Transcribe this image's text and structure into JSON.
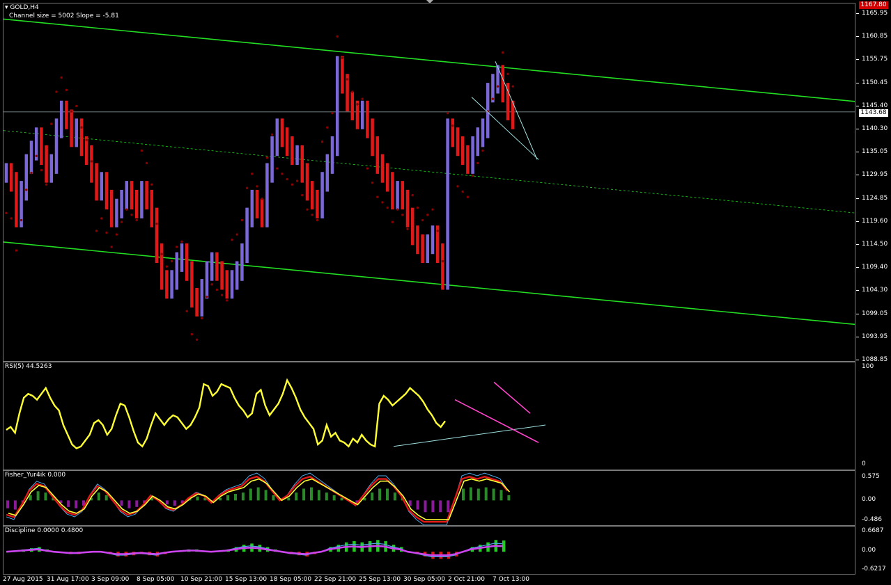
{
  "header": {
    "window_title": "GOLD,H4",
    "channel_info": "Channel size = 5002 Slope = -5.81"
  },
  "colors": {
    "bull": "#7b68d6",
    "bear": "#e01818",
    "channel": "#22dd22",
    "psar": "#8b0000",
    "rsi": "#ffff33",
    "trend_pink": "#ff44cc",
    "trend_cyan": "#9fe0e0"
  },
  "price_axis": {
    "ticks": [
      "1165.95",
      "1160.85",
      "1155.75",
      "1150.45",
      "1145.40",
      "1140.30",
      "1135.05",
      "1129.95",
      "1124.85",
      "1119.60",
      "1114.50",
      "1109.40",
      "1104.30",
      "1099.05",
      "1093.95",
      "1088.85"
    ],
    "current_price": "1143.68",
    "top_price": "1167.80"
  },
  "x_axis": {
    "labels": [
      "27 Aug 2015",
      "31 Aug 17:00",
      "3 Sep 09:00",
      "8 Sep 05:00",
      "10 Sep 21:00",
      "15 Sep 13:00",
      "18 Sep 05:00",
      "22 Sep 21:00",
      "25 Sep 13:00",
      "30 Sep 05:00",
      "2 Oct 21:00",
      "7 Oct 13:00"
    ]
  },
  "indicators": {
    "rsi": {
      "label": "RSI(5) 44.5263",
      "ticks": [
        "100",
        "0"
      ]
    },
    "fisher": {
      "label": "Fisher_Yur4ik 0.000",
      "ticks": [
        "0.575",
        "0.00",
        "-0.486"
      ]
    },
    "discipline": {
      "label": "Discipline 0.0000 0.4800",
      "ticks": [
        "0.6687",
        "0.00",
        "-0.6217"
      ]
    }
  },
  "chart_data": [
    {
      "type": "bar",
      "title": "GOLD,H4",
      "subtitle": "Channel size = 5002 Slope = -5.81",
      "ylim": [
        1087.5,
        1168.0
      ],
      "closes": [
        1130,
        1128,
        1120,
        1126,
        1132,
        1135,
        1138,
        1134,
        1130,
        1132,
        1140,
        1144,
        1142,
        1138,
        1140,
        1136,
        1134,
        1130,
        1126,
        1128,
        1124,
        1120,
        1122,
        1124,
        1126,
        1124,
        1122,
        1126,
        1124,
        1120,
        1112,
        1106,
        1104,
        1106,
        1110,
        1112,
        1108,
        1102,
        1100,
        1104,
        1108,
        1110,
        1108,
        1106,
        1104,
        1106,
        1108,
        1112,
        1120,
        1124,
        1122,
        1120,
        1130,
        1136,
        1140,
        1138,
        1136,
        1134,
        1134,
        1130,
        1126,
        1124,
        1122,
        1128,
        1132,
        1136,
        1154,
        1150,
        1146,
        1144,
        1142,
        1144,
        1140,
        1136,
        1132,
        1130,
        1128,
        1124,
        1126,
        1124,
        1120,
        1116,
        1114,
        1112,
        1114,
        1116,
        1112,
        1106,
        1140,
        1138,
        1136,
        1134,
        1132,
        1136,
        1138,
        1140,
        1148,
        1150,
        1152,
        1148,
        1144,
        1142
      ],
      "channel": {
        "upper": [
          1164.5,
          1146.0
        ],
        "middle": [
          1139.5,
          1121.0
        ],
        "lower": [
          1114.5,
          1096.0
        ]
      }
    },
    {
      "type": "line",
      "title": "RSI(5) 44.5263",
      "ylim": [
        0,
        100
      ],
      "values": [
        35,
        38,
        32,
        52,
        68,
        72,
        70,
        66,
        72,
        78,
        68,
        60,
        55,
        40,
        30,
        20,
        16,
        18,
        24,
        30,
        42,
        45,
        40,
        30,
        36,
        50,
        62,
        60,
        48,
        34,
        22,
        18,
        26,
        40,
        52,
        46,
        40,
        46,
        50,
        48,
        42,
        36,
        40,
        48,
        58,
        82,
        80,
        70,
        74,
        82,
        80,
        78,
        68,
        60,
        55,
        48,
        52,
        72,
        76,
        60,
        50,
        56,
        62,
        72,
        86,
        78,
        68,
        56,
        48,
        42,
        36,
        20,
        24,
        40,
        28,
        32,
        24,
        22,
        18,
        26,
        22,
        30,
        24,
        20,
        18,
        62,
        70,
        66,
        60,
        64,
        68,
        72,
        78,
        74,
        70,
        64,
        56,
        50,
        42,
        38,
        44
      ]
    },
    {
      "type": "line",
      "title": "Fisher_Yur4ik 0.000",
      "ylim": [
        -0.55,
        0.62
      ],
      "values": [
        -0.3,
        -0.35,
        -0.1,
        0.2,
        0.35,
        0.3,
        0.1,
        -0.1,
        -0.25,
        -0.3,
        -0.2,
        0.1,
        0.3,
        0.2,
        0.0,
        -0.2,
        -0.3,
        -0.25,
        -0.1,
        0.1,
        0.0,
        -0.15,
        -0.2,
        -0.1,
        0.05,
        0.15,
        0.1,
        -0.05,
        0.1,
        0.2,
        0.25,
        0.3,
        0.45,
        0.5,
        0.4,
        0.2,
        0.0,
        0.1,
        0.3,
        0.45,
        0.5,
        0.4,
        0.3,
        0.2,
        0.1,
        0.0,
        -0.1,
        0.1,
        0.3,
        0.45,
        0.45,
        0.3,
        0.1,
        -0.2,
        -0.35,
        -0.45,
        -0.45,
        -0.45,
        -0.45,
        0.0,
        0.45,
        0.5,
        0.45,
        0.5,
        0.45,
        0.4,
        0.2
      ]
    },
    {
      "type": "line",
      "title": "Discipline 0.0000 0.4800",
      "ylim": [
        -0.7,
        0.75
      ],
      "values": [
        0.0,
        0.05,
        0.1,
        0.15,
        0.2,
        0.1,
        0.0,
        -0.05,
        -0.1,
        -0.1,
        -0.05,
        0.0,
        0.0,
        -0.1,
        -0.2,
        -0.2,
        -0.15,
        -0.1,
        -0.15,
        -0.2,
        -0.1,
        0.0,
        0.05,
        0.1,
        0.1,
        0.05,
        0.0,
        0.05,
        0.1,
        0.2,
        0.3,
        0.35,
        0.3,
        0.2,
        0.1,
        0.0,
        -0.1,
        -0.15,
        -0.2,
        -0.1,
        0.0,
        0.2,
        0.3,
        0.4,
        0.45,
        0.4,
        0.45,
        0.5,
        0.45,
        0.3,
        0.2,
        0.0,
        -0.1,
        -0.2,
        -0.3,
        -0.3,
        -0.3,
        -0.2,
        0.0,
        0.2,
        0.3,
        0.4,
        0.5,
        0.48
      ]
    }
  ]
}
